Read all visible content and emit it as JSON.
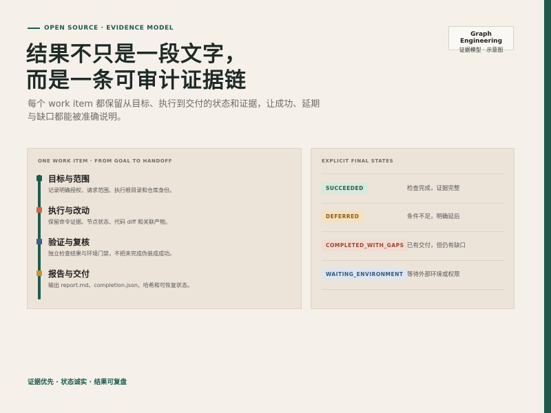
{
  "eyebrow": "OPEN SOURCE · EVIDENCE MODEL",
  "brand": {
    "title": "Graph Engineering",
    "subtitle": "证据模型 · 示意图"
  },
  "headline": {
    "line1": "结果不只是一段文字，",
    "line2": "而是一条可审计证据链"
  },
  "subtitle": "每个 work item 都保留从目标、执行到交付的状态和证据，让成功、延期与缺口都能被准确说明。",
  "left_card": {
    "title": "ONE WORK ITEM · FROM GOAL TO HANDOFF",
    "steps": [
      {
        "title": "目标与范围",
        "desc": "记录明确授权、请求范围、执行根目录和仓库身份。",
        "color": "#1e5b4c"
      },
      {
        "title": "执行与改动",
        "desc": "保留命令证据、节点状态、代码 diff 和关联产物。",
        "color": "#c8684a"
      },
      {
        "title": "验证与复核",
        "desc": "独立检查结果与环境门禁，不把未完成伪装成成功。",
        "color": "#3d5f87"
      },
      {
        "title": "报告与交付",
        "desc": "输出 report.md、completion.json、哈希和可恢复状态。",
        "color": "#c9942f"
      }
    ]
  },
  "right_card": {
    "title": "EXPLICIT FINAL STATES",
    "states": [
      {
        "label": "SUCCEEDED",
        "desc": "检查完成，证据完整",
        "bg": "#d8e9dd",
        "fg": "#1e5b4c"
      },
      {
        "label": "DEFERRED",
        "desc": "条件不足，明确延后",
        "bg": "#f3e2bd",
        "fg": "#8a5a17"
      },
      {
        "label": "COMPLETED_WITH_GAPS",
        "desc": "已有交付，但仍有缺口",
        "bg": "#f1dcd2",
        "fg": "#9a4630"
      },
      {
        "label": "WAITING_ENVIRONMENT",
        "desc": "等待外部环境或权限",
        "bg": "#dde6f0",
        "fg": "#34557e"
      }
    ]
  },
  "footer": "证据优先 · 状态诚实 · 结果可复盘"
}
